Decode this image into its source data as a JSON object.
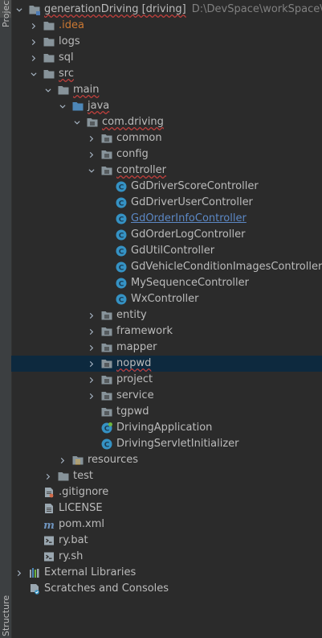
{
  "side_tabs": {
    "project": "Project",
    "structure": "Structure"
  },
  "tree": [
    {
      "label": "generationDriving [driving]",
      "path": "D:\\DevSpace\\workSpace\\git",
      "level": 0,
      "arrow": "down",
      "icon": "module-folder-icon",
      "squiggly": true
    },
    {
      "label": ".idea",
      "level": 1,
      "arrow": "right",
      "icon": "folder-icon",
      "color": "#cc7832"
    },
    {
      "label": "logs",
      "level": 1,
      "arrow": "right",
      "icon": "folder-icon"
    },
    {
      "label": "sql",
      "level": 1,
      "arrow": "right",
      "icon": "folder-icon"
    },
    {
      "label": "src",
      "level": 1,
      "arrow": "down",
      "icon": "folder-icon",
      "squiggly": true
    },
    {
      "label": "main",
      "level": 2,
      "arrow": "down",
      "icon": "folder-icon",
      "squiggly": true
    },
    {
      "label": "java",
      "level": 3,
      "arrow": "down",
      "icon": "source-folder-icon",
      "squiggly": true
    },
    {
      "label": "com.driving",
      "level": 4,
      "arrow": "down",
      "icon": "package-icon",
      "squiggly": true
    },
    {
      "label": "common",
      "level": 5,
      "arrow": "right",
      "icon": "package-icon"
    },
    {
      "label": "config",
      "level": 5,
      "arrow": "right",
      "icon": "package-icon"
    },
    {
      "label": "controller",
      "level": 5,
      "arrow": "down",
      "icon": "package-icon",
      "squiggly": true
    },
    {
      "label": "GdDriverScoreController",
      "level": 6,
      "icon": "class-icon"
    },
    {
      "label": "GdDriverUserController",
      "level": 6,
      "icon": "class-icon"
    },
    {
      "label": "GdOrderInfoController",
      "level": 6,
      "icon": "class-icon",
      "link": true
    },
    {
      "label": "GdOrderLogController",
      "level": 6,
      "icon": "class-icon"
    },
    {
      "label": "GdUtilController",
      "level": 6,
      "icon": "class-icon"
    },
    {
      "label": "GdVehicleConditionImagesController",
      "level": 6,
      "icon": "class-icon"
    },
    {
      "label": "MySequenceController",
      "level": 6,
      "icon": "class-icon"
    },
    {
      "label": "WxController",
      "level": 6,
      "icon": "class-icon"
    },
    {
      "label": "entity",
      "level": 5,
      "arrow": "right",
      "icon": "package-icon"
    },
    {
      "label": "framework",
      "level": 5,
      "arrow": "right",
      "icon": "package-icon"
    },
    {
      "label": "mapper",
      "level": 5,
      "arrow": "right",
      "icon": "package-icon"
    },
    {
      "label": "nopwd",
      "level": 5,
      "arrow": "right",
      "icon": "package-icon",
      "selected": true,
      "squiggly": true
    },
    {
      "label": "project",
      "level": 5,
      "arrow": "right",
      "icon": "package-icon"
    },
    {
      "label": "service",
      "level": 5,
      "arrow": "right",
      "icon": "package-icon"
    },
    {
      "label": "tgpwd",
      "level": 5,
      "icon": "package-icon"
    },
    {
      "label": "DrivingApplication",
      "level": 5,
      "icon": "spring-class-icon"
    },
    {
      "label": "DrivingServletInitializer",
      "level": 5,
      "icon": "class-icon"
    },
    {
      "label": "resources",
      "level": 3,
      "arrow": "right",
      "icon": "resources-folder-icon"
    },
    {
      "label": "test",
      "level": 2,
      "arrow": "right",
      "icon": "folder-icon"
    },
    {
      "label": ".gitignore",
      "level": 1,
      "icon": "gitignore-file-icon"
    },
    {
      "label": "LICENSE",
      "level": 1,
      "icon": "text-file-icon"
    },
    {
      "label": "pom.xml",
      "level": 1,
      "icon": "maven-file-icon"
    },
    {
      "label": "ry.bat",
      "level": 1,
      "icon": "bat-file-icon"
    },
    {
      "label": "ry.sh",
      "level": 1,
      "icon": "shell-file-icon"
    },
    {
      "label": "External Libraries",
      "level": 0,
      "arrow": "right",
      "icon": "libraries-icon"
    },
    {
      "label": "Scratches and Consoles",
      "level": 0,
      "icon": "scratches-icon"
    }
  ],
  "colors": {
    "selection": "#0d293e",
    "folder": "#87939a",
    "class": "#3592c4",
    "link": "#5c88c5",
    "excluded": "#cc7832"
  }
}
